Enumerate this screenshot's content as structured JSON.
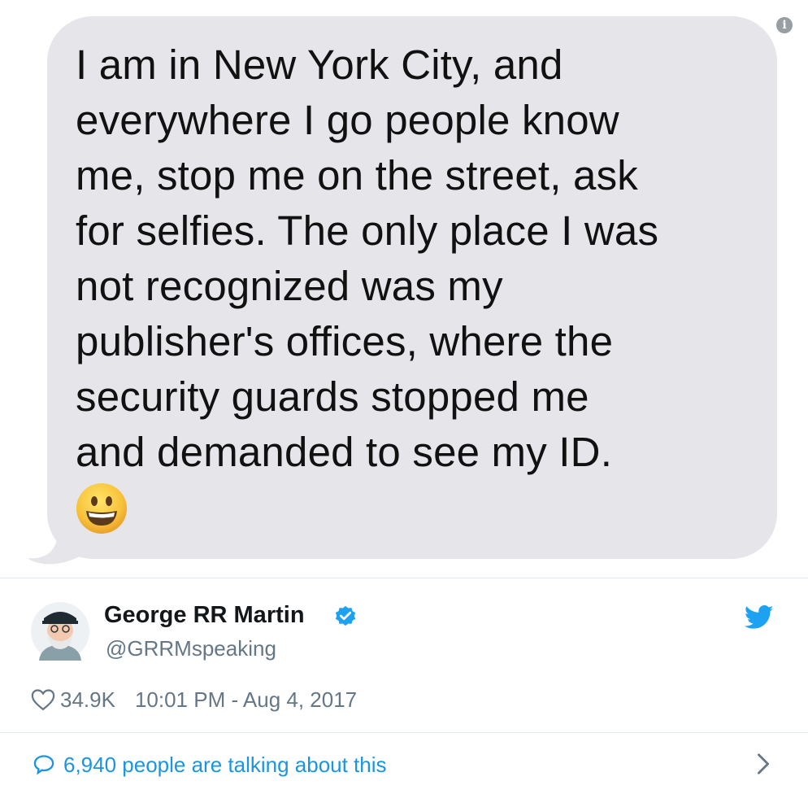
{
  "message": {
    "text": "I am in New York City, and\neverywhere I go people know\nme, stop me on the street, ask\nfor selfies. The only place I was\nnot recognized was my\npublisher's offices, where the\nsecurity guards stopped me\nand demanded to see my ID.",
    "emoji": "grinning-face-emoji",
    "bubble_color": "#e5e5ea"
  },
  "tweet": {
    "author_name": "George RR Martin",
    "handle": "@GRRMspeaking",
    "verified": true,
    "likes": "34.9K",
    "timestamp": "10:01 PM - Aug 4, 2017",
    "talk_text": "6,940 people are talking about this",
    "brand_color": "#1da1f2",
    "link_color": "#1b95e0"
  },
  "icons": {
    "info": "info-icon",
    "verified": "verified-badge-icon",
    "twitter": "twitter-bird-icon",
    "heart": "heart-icon",
    "reply": "speech-bubble-icon",
    "chevron": "chevron-right-icon"
  }
}
